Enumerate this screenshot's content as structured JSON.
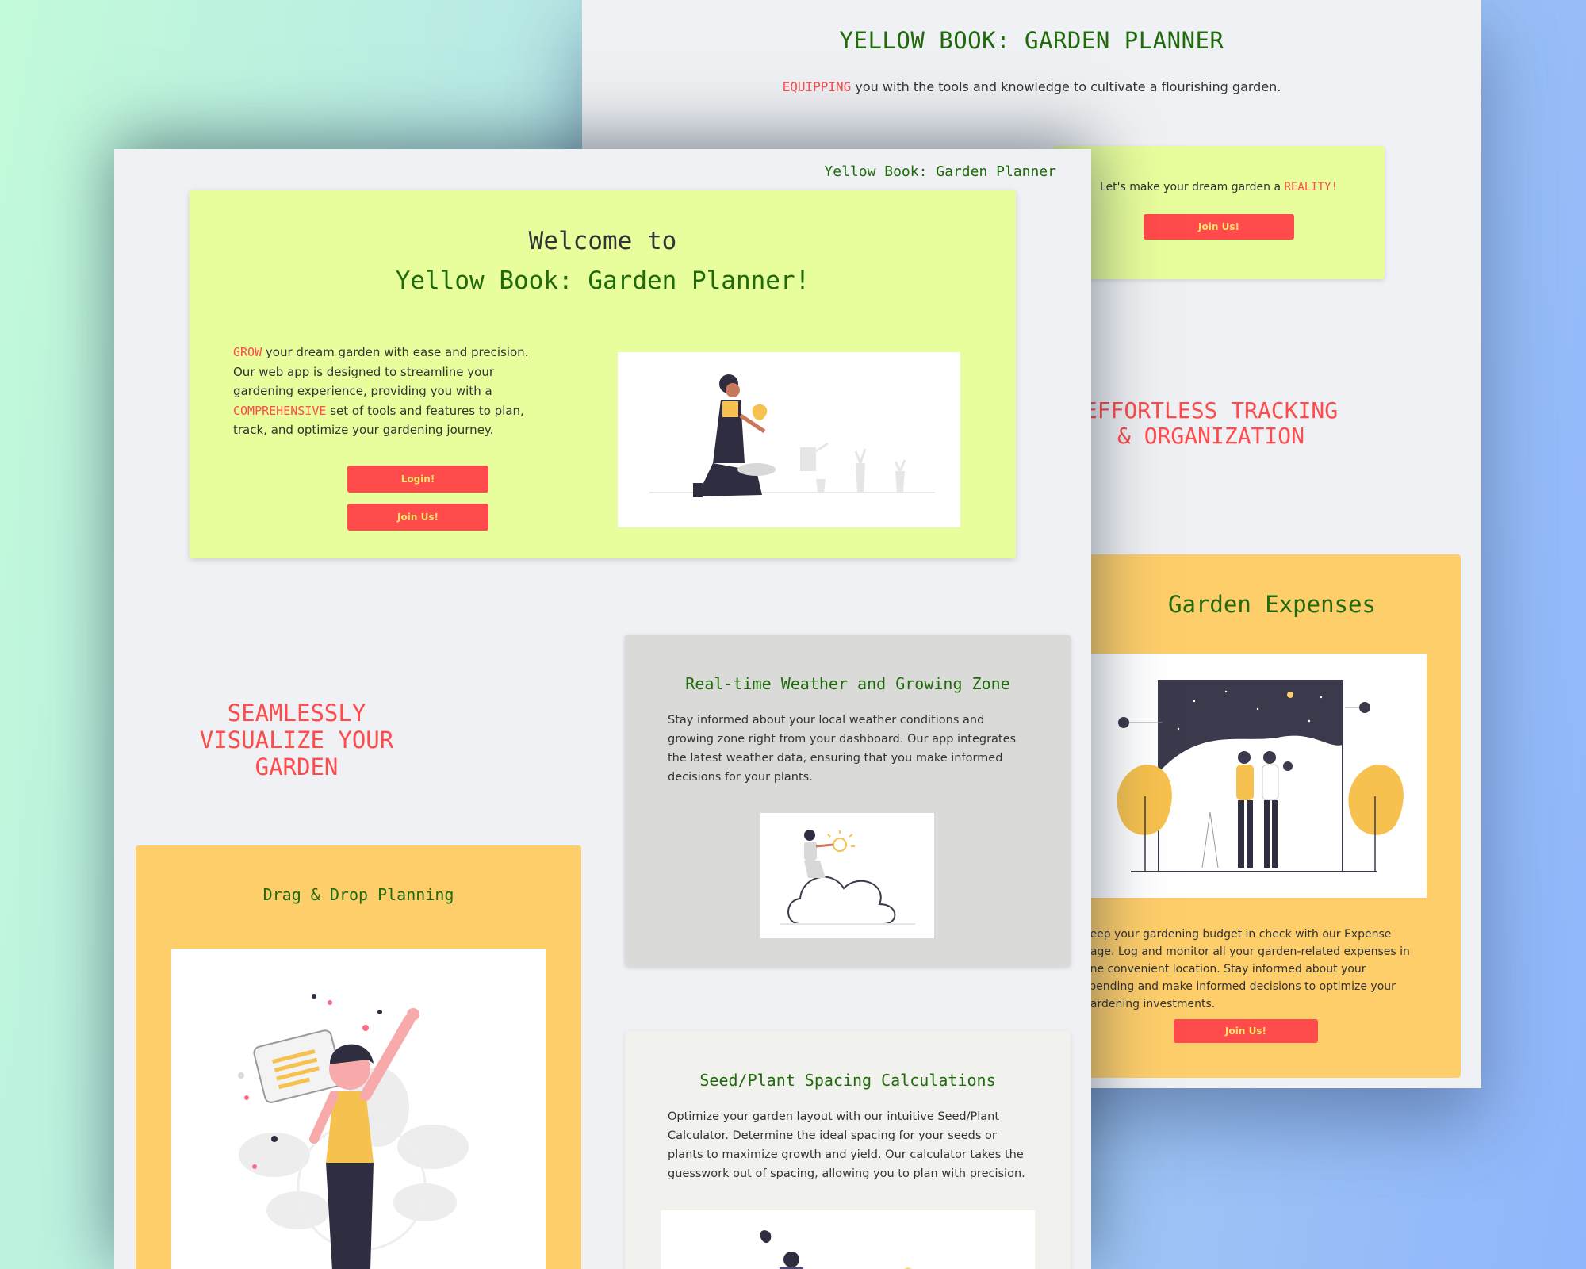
{
  "back": {
    "title": "YELLOW BOOK: GARDEN PLANNER",
    "subtitle_hl": "EQUIPPING",
    "subtitle_rest": " you with the tools and knowledge to cultivate a flourishing garden.",
    "cta_text": "Let's make your dream garden a ",
    "cta_hl": "REALITY!",
    "cta_button": "Join Us!",
    "tracking_heading": "EFFORTLESS TRACKING & ORGANIZATION",
    "expenses": {
      "title": "Garden Expenses",
      "text": "Keep your gardening budget in check with our Expense page. Log and monitor all your garden-related expenses in one convenient location. Stay informed about your spending and make informed decisions to optimize your gardening investments.",
      "button": "Join Us!"
    }
  },
  "front": {
    "brand": "Yellow Book: Garden Planner",
    "hero": {
      "welcome_line1": "Welcome to",
      "welcome_line2": "Yellow Book: Garden Planner!",
      "hl1": "GROW",
      "text1": "  your dream garden with ease and precision. Our web app is designed to streamline your gardening experience, providing you with a ",
      "hl2": "COMPREHENSIVE",
      "text2": "  set of tools and features to plan, track, and optimize your gardening journey.",
      "login_button": "Login!",
      "join_button": "Join Us!"
    },
    "visualize_heading": "SEAMLESSLY VISUALIZE YOUR GARDEN",
    "weather": {
      "title": "Real-time Weather and Growing Zone",
      "text": "Stay informed about your local weather conditions and growing zone right from your dashboard. Our app integrates the latest weather data, ensuring that you make informed decisions for your plants."
    },
    "seed": {
      "title": "Seed/Plant Spacing Calculations",
      "text": "Optimize your garden layout with our intuitive Seed/Plant Calculator. Determine the ideal spacing for your seeds or plants to maximize growth and yield. Our calculator takes the guesswork out of spacing, allowing you to plan with precision."
    },
    "drag": {
      "title": "Drag & Drop Planning"
    }
  },
  "colors": {
    "accent_red": "#ff4b4b",
    "title_green": "#1f6b0c",
    "hero_bg": "#e8fd9b",
    "card_yellow": "#fece6b",
    "page_bg": "#f0f1f4"
  }
}
